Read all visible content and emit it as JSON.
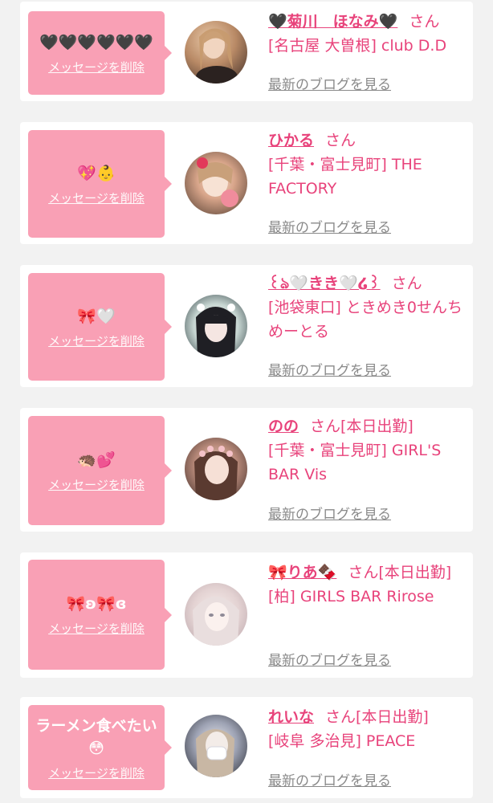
{
  "colors": {
    "accent_pink": "#e8437b",
    "bubble_pink": "#f9a0b5",
    "link_gray": "#8a8a8a",
    "background": "#f2f2f2",
    "card": "#ffffff"
  },
  "labels": {
    "delete": "メッセージを削除",
    "blog": "最新のブログを見る"
  },
  "messages": [
    {
      "bubble_text": "🖤🖤🖤🖤🖤🖤",
      "name": "🖤菊川　ほなみ🖤",
      "suffix": "さん",
      "shop": "[名古屋 大曽根] club D.D",
      "avatar": "profile-photo-1"
    },
    {
      "bubble_text": "💖👶",
      "name": "ひかる",
      "suffix": "さん",
      "shop": "[千葉・富士見町] THE FACTORY",
      "avatar": "profile-photo-2"
    },
    {
      "bubble_text": "🎀🤍",
      "name": "꒰ঌ🤍きき🤍໒꒱",
      "suffix": "さん",
      "shop": "[池袋東口] ときめき0せんちめーとる",
      "avatar": "profile-photo-3"
    },
    {
      "bubble_text": "🦔💕",
      "name": "のの",
      "suffix": "さん[本日出勤]",
      "shop": "[千葉・富士見町] GIRL'S BAR Vis",
      "avatar": "profile-photo-4"
    },
    {
      "bubble_text": "🎀ʚ🎀ɞ",
      "name": "🎀りあ🍫",
      "suffix": "さん[本日出勤]",
      "shop": "[柏] GIRLS BAR Rirose",
      "avatar": "profile-photo-5"
    },
    {
      "bubble_text": "ラーメン食べたい\n😳",
      "name": "れいな",
      "suffix": "さん[本日出勤]",
      "shop": "[岐阜 多治見] PEACE",
      "avatar": "profile-photo-6"
    }
  ]
}
